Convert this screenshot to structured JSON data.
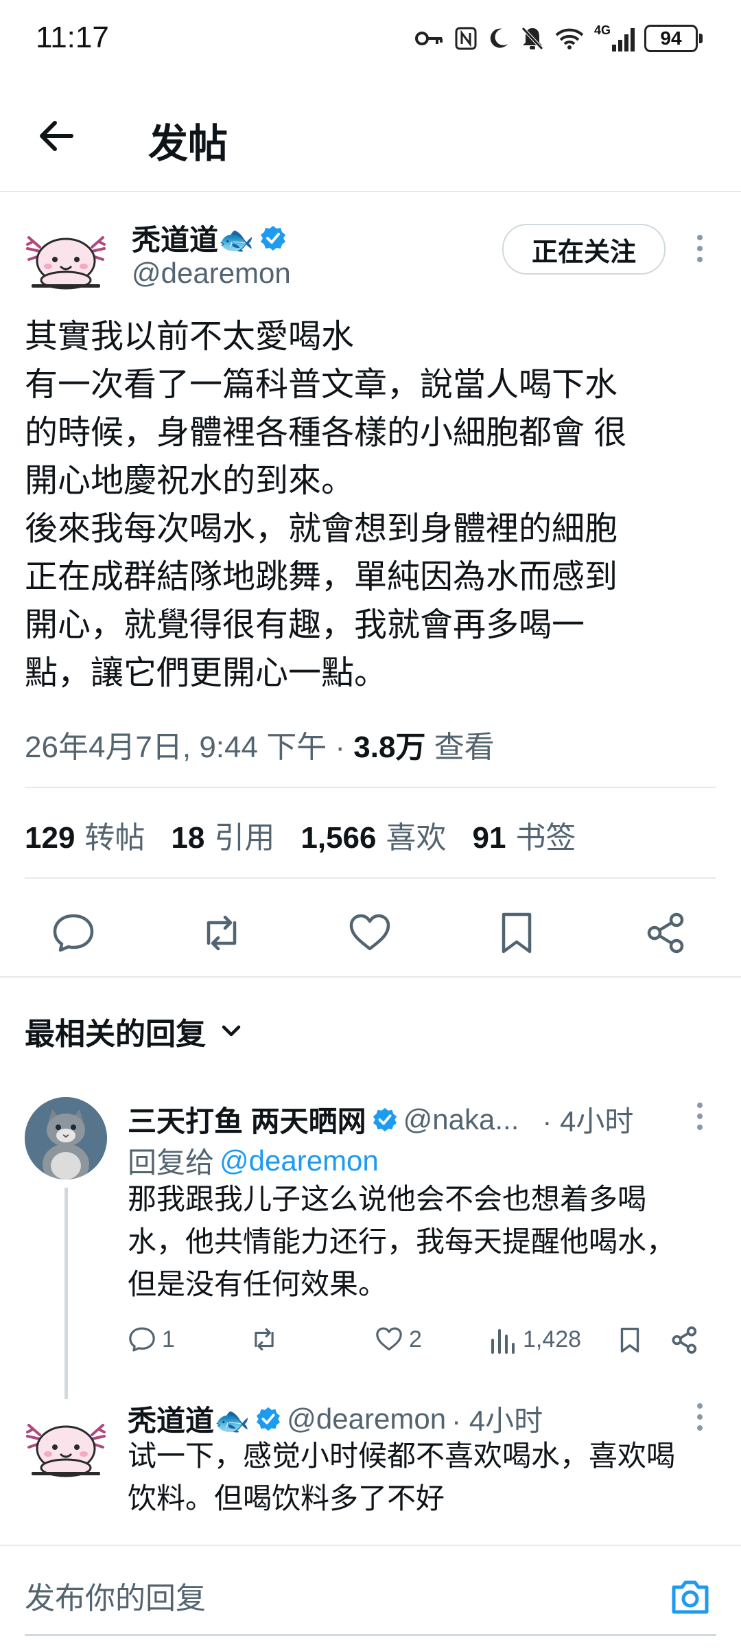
{
  "status_bar": {
    "time": "11:17",
    "network": "4G",
    "battery": "94",
    "icons": [
      "key-icon",
      "nfc-icon",
      "moon-icon",
      "bell-off-icon",
      "wifi-icon",
      "cellular-signal-icon",
      "battery-icon"
    ]
  },
  "header": {
    "back_icon": "arrow-left-icon",
    "title": "发帖"
  },
  "post": {
    "author_name": "秃道道🐟",
    "author_handle": "@dearemon",
    "verified": true,
    "follow_label": "正在关注",
    "lines": [
      "其實我以前不太愛喝水",
      "有一次看了一篇科普文章，說當人喝下水",
      "的時候，身體裡各種各樣的小細胞都會 很",
      "開心地慶祝水的到來。",
      "後來我每次喝水，就會想到身體裡的細胞",
      "正在成群結隊地跳舞，單純因為水而感到",
      "開心，就覺得很有趣，我就會再多喝一",
      "點，讓它們更開心一點。"
    ],
    "timestamp": "26年4月7日, 9:44 下午 · ",
    "views_count": "3.8万",
    "views_label": " 查看"
  },
  "stats": [
    {
      "count": "129",
      "label": "转帖"
    },
    {
      "count": "18",
      "label": "引用"
    },
    {
      "count": "1,566",
      "label": "喜欢"
    },
    {
      "count": "91",
      "label": "书签"
    }
  ],
  "actions": [
    "reply-icon",
    "repost-icon",
    "like-icon",
    "bookmark-icon",
    "share-icon"
  ],
  "replies_section": {
    "sort_label": "最相关的回复"
  },
  "reply1": {
    "name": "三天打鱼 两天晒网",
    "verified": true,
    "handle": "@naka...",
    "time": "· 4小时",
    "reply_to_label": "回复给",
    "reply_to_handle": " @dearemon",
    "lines": [
      "那我跟我儿子这么说他会不会也想着多喝",
      "水，他共情能力还行，我每天提醒他喝水，",
      "但是没有任何效果。"
    ],
    "reply_count": "1",
    "like_count": "2",
    "view_count": "1,428"
  },
  "reply2": {
    "name": "秃道道🐟",
    "verified": true,
    "handle": "@dearemon",
    "time": "· 4小时",
    "lines": [
      "试一下，感觉小时候都不喜欢喝水，喜欢喝",
      "饮料。但喝饮料多了不好"
    ]
  },
  "composer": {
    "placeholder": "发布你的回复",
    "camera_icon": "camera-icon"
  },
  "colors": {
    "accent": "#1d9bf0",
    "text": "#0f1419",
    "secondary": "#536471",
    "divider": "#e6e9ec"
  }
}
